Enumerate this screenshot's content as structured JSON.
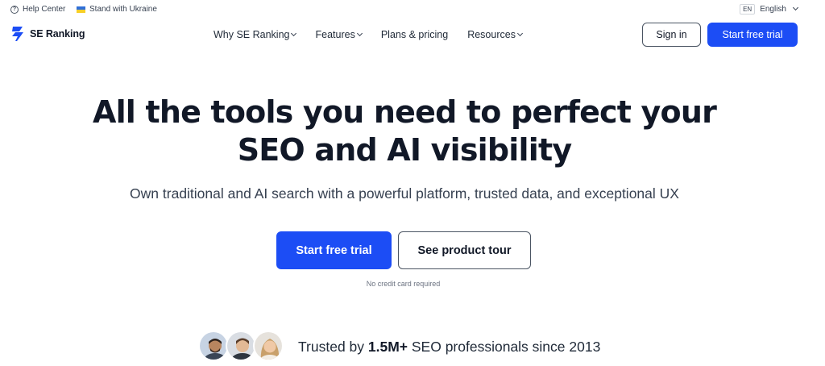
{
  "topbar": {
    "help_label": "Help Center",
    "ukraine_label": "Stand with Ukraine",
    "lang_code": "EN",
    "lang_label": "English"
  },
  "header": {
    "brand": "SE Ranking",
    "nav": [
      "Why SE Ranking",
      "Features",
      "Plans & pricing",
      "Resources"
    ],
    "signin_label": "Sign in",
    "trial_label": "Start free trial"
  },
  "hero": {
    "title_line1": "All the tools you need to perfect your",
    "title_line2": "SEO and AI visibility",
    "subtitle": "Own traditional and AI search with a powerful platform, trusted data, and exceptional UX",
    "cta_primary": "Start free trial",
    "cta_secondary": "See product tour",
    "note": "No credit card required"
  },
  "trust": {
    "prefix": "Trusted by ",
    "count": "1.5M+",
    "suffix": " SEO professionals since 2013"
  },
  "colors": {
    "accent": "#1c4df5",
    "text": "#111827"
  }
}
